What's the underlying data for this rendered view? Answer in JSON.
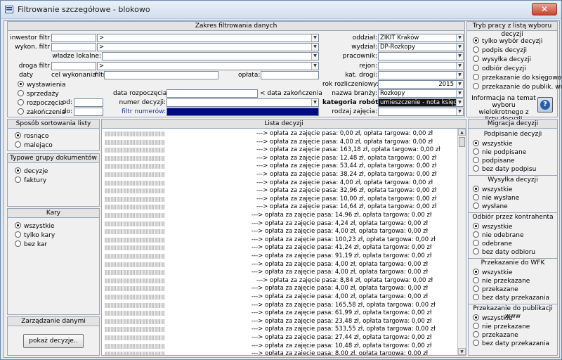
{
  "window": {
    "title": "Filtrowanie szczegółowe - blokowo",
    "close_glyph": "✕"
  },
  "filter": {
    "header": "Zakres filtrowania danych",
    "inwestor_label": "inwestor filtr",
    "wykon_label": "wykon. filtr",
    "wladze_label": "władze lokalne:",
    "droga_label": "droga filtr",
    "arrow": ">",
    "daty_label": "daty",
    "cel_label": "cel wykonania",
    "filtr_label": "filtr",
    "oplata_label": "opłata:",
    "oddzial_label": "oddział:",
    "oddzial_value": "ZIKIT Kraków",
    "wydzial_label": "wydział:",
    "wydzial_value": "DP-Rozkopy",
    "pracownik_label": "pracownik:",
    "rejon_label": "rejon:",
    "kat_drogi_label": "kat. drogi:",
    "rok_label": "rok rozliczeniowy:",
    "rok_value": "2015",
    "nazwa_branzy_label": "nazwa branży:",
    "nazwa_branzy_value": "Rozkopy",
    "kategoria_label": "kategoria robót:",
    "kategoria_value": "umieszczenie - nota księgowa",
    "rodzaj_label": "rodzaj zajęcia:",
    "date_radios": [
      "wystawienia",
      "sprzedaży",
      "rozpoczęcia",
      "zakończenia"
    ],
    "od_label": "od:",
    "do_label": "do:",
    "data_rozp_label": "data rozpoczęcia <",
    "data_zak_label": "< data zakończenia",
    "numer_label": "numer decyzji:",
    "filtr_numerow_label": "filtr numerów:"
  },
  "tryb": {
    "header": "Tryb pracy z listą wyboru decyzji",
    "options": [
      "tylko wybór decyzji",
      "podpis decyzji",
      "wysyłka decyzji",
      "odbiór decyzji",
      "przekazanie do księgowości",
      "przekazanie do publik. www"
    ],
    "info": "Informacja na temat wyboru wielokrotnego z listy decyzji",
    "help_glyph": "?"
  },
  "sort": {
    "header": "Sposób sortowania listy",
    "options": [
      "rosnąco",
      "malejąco"
    ]
  },
  "typowe": {
    "header": "Typowe grupy dokumentów",
    "options": [
      "decyzje",
      "faktury"
    ]
  },
  "kary": {
    "header": "Kary",
    "options": [
      "wszystkie",
      "tylko kary",
      "bez kar"
    ]
  },
  "zarzadzanie": {
    "header": "Zarządzanie danymi",
    "button": "pokaż decyzje.."
  },
  "lista": {
    "header": "Lista decyzji",
    "rows": [
      "---> opłata za zajęcie pasa: 0,00 zł, opłata targowa: 0,00 zł",
      "---> opłata za zajęcie pasa: 4,00 zł, opłata targowa: 0,00 zł",
      "---> opłata za zajęcie pasa: 163,18 zł, opłata targowa: 0,00 zł",
      "---> opłata za zajęcie pasa: 12,48 zł, opłata targowa: 0,00 zł",
      "---> opłata za zajęcie pasa: 53,44 zł, opłata targowa: 0,00 zł",
      "---> opłata za zajęcie pasa: 38,24 zł, opłata targowa: 0,00 zł",
      "---> opłata za zajęcie pasa: 4,00 zł, opłata targowa: 0,00 zł",
      "---> opłata za zajęcie pasa: 32,96 zł, opłata targowa: 0,00 zł",
      "---> opłata za zajęcie pasa: 10,00 zł, opłata targowa: 0,00 zł",
      "---> opłata za zajęcie pasa: 14,64 zł, opłata targowa: 0,00 zł",
      "---> opłata za zajęcie pasa: 14,96 zł, opłata targowa: 0,00 zł",
      "---> opłata za zajęcie pasa: 4,24 zł, opłata targowa: 0,00 zł",
      "---> opłata za zajęcie pasa: 4,00 zł, opłata targowa: 0,00 zł",
      "---> opłata za zajęcie pasa: 100,23 zł, opłata targowa: 0,00 zł",
      "---> opłata za zajęcie pasa: 41,24 zł, opłata targowa: 0,00 zł",
      "---> opłata za zajęcie pasa: 91,19 zł, opłata targowa: 0,00 zł",
      "---> opłata za zajęcie pasa: 4,00 zł, opłata targowa: 0,00 zł",
      "---> opłata za zajęcie pasa: 4,00 zł, opłata targowa: 0,00 zł",
      "---> opłata za zajęcie pasa: 8,84 zł, opłata targowa: 0,00 zł",
      "---> opłata za zajęcie pasa: 4,00 zł, opłata targowa: 0,00 zł",
      "---> opłata za zajęcie pasa: 4,00 zł, opłata targowa: 0,00 zł",
      "---> opłata za zajęcie pasa: 165,58 zł, opłata targowa: 0,00 zł",
      "---> opłata za zajęcie pasa: 61,99 zł, opłata targowa: 0,00 zł",
      "---> opłata za zajęcie pasa: 23,48 zł, opłata targowa: 0,00 zł",
      "---> opłata za zajęcie pasa: 533,55 zł, opłata targowa: 0,00 zł",
      "---> opłata za zajęcie pasa: 27,44 zł, opłata targowa: 0,00 zł",
      "---> opłata za zajęcie pasa: 10,48 zł, opłata targowa: 0,00 zł",
      "---> opłata za zajęcie pasa: 8,00 zł, opłata targowa: 0,00 zł",
      "---> opłata za zajęcie pasa: 71,12 zł, opłata targowa: 0,00 zł"
    ]
  },
  "migracja": {
    "header": "Migracja decyzji",
    "groups": [
      {
        "title": "Podpisanie decyzji",
        "options": [
          "wszystkie",
          "nie podpisane",
          "podpisane",
          "bez daty podpisu"
        ]
      },
      {
        "title": "Wysyłka decyzji",
        "options": [
          "wszystkie",
          "nie wysłane",
          "wysłane"
        ]
      },
      {
        "title": "Odbiór przez kontrahenta",
        "options": [
          "wszystkie",
          "nie odebrane",
          "odebrane",
          "bez daty odbioru"
        ]
      },
      {
        "title": "Przekazanie do WFK",
        "options": [
          "wszystkie",
          "nie przekazane",
          "przekazane",
          "bez daty przekazania"
        ]
      },
      {
        "title": "Przekazanie do publikacji www",
        "options": [
          "wszystkie",
          "nie przekazane",
          "przekazane",
          "bez daty przekazania"
        ]
      }
    ]
  }
}
